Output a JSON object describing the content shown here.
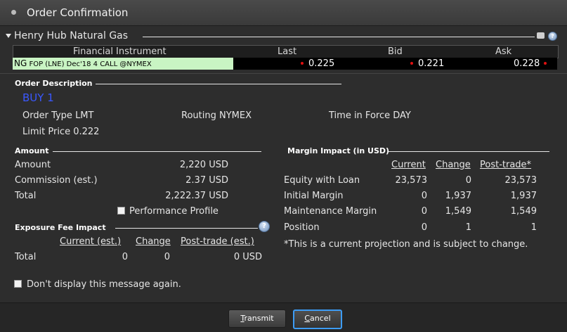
{
  "window": {
    "title": "Order Confirmation"
  },
  "instrument_group": {
    "title": "Henry Hub Natural Gas"
  },
  "quote_table": {
    "headers": [
      "Financial Instrument",
      "Last",
      "Bid",
      "Ask"
    ],
    "row": {
      "symbol": "NG",
      "description": "FOP (LNE) Dec'18 4 CALL @NYMEX",
      "last": "0.225",
      "bid": "0.221",
      "ask": "0.228"
    }
  },
  "order_description": {
    "title": "Order Description",
    "action": "BUY 1",
    "order_type": "Order Type LMT",
    "routing": "Routing NYMEX",
    "time_in_force": "Time in Force DAY",
    "limit_price": "Limit Price  0.222"
  },
  "amount": {
    "title": "Amount",
    "rows": [
      {
        "label": "Amount",
        "value": "2,220 USD"
      },
      {
        "label": "Commission (est.)",
        "value": "2.37 USD"
      },
      {
        "label": "Total",
        "value": "2,222.37 USD"
      }
    ],
    "performance_profile": "Performance Profile"
  },
  "exposure_fee": {
    "title": "Exposure Fee Impact",
    "headers": [
      "Current (est.)",
      "Change",
      "Post-trade (est.)"
    ],
    "row": {
      "label": "Total",
      "current": "0",
      "change": "0",
      "post": "0 USD"
    }
  },
  "margin_impact": {
    "title": "Margin Impact (in USD)",
    "headers": [
      "Current",
      "Change",
      "Post-trade*"
    ],
    "rows": [
      {
        "label": "Equity with Loan",
        "current": "23,573",
        "change": "0",
        "post": "23,573"
      },
      {
        "label": "Initial Margin",
        "current": "0",
        "change": "1,937",
        "post": "1,937"
      },
      {
        "label": "Maintenance Margin",
        "current": "0",
        "change": "1,549",
        "post": "1,549"
      },
      {
        "label": "Position",
        "current": "0",
        "change": "1",
        "post": "1"
      }
    ],
    "note": "*This is a current projection and is subject to change."
  },
  "dont_display": "Don't display this message again.",
  "buttons": {
    "transmit": "Transmit",
    "transmit_rest": "ransmit",
    "transmit_key": "T",
    "cancel_key": "C",
    "cancel_rest": "ancel"
  },
  "colors": {
    "buy": "#3a58ff",
    "instrument_bg": "#c9f4c3",
    "cancel_focus": "#3d9cf5"
  }
}
